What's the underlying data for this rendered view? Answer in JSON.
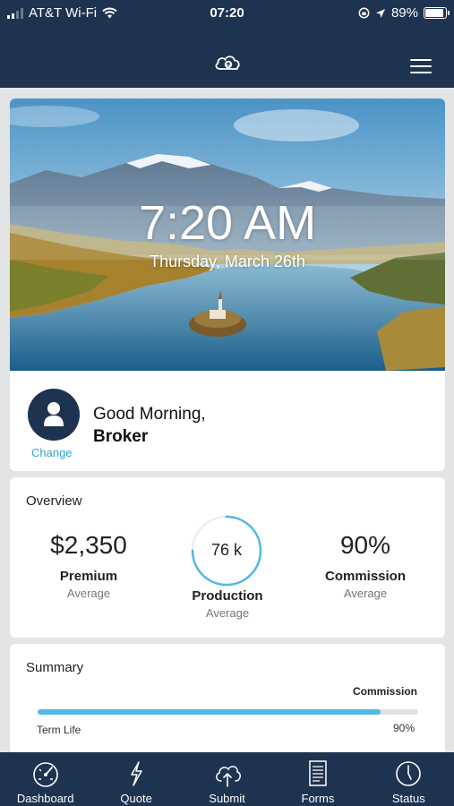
{
  "status_bar": {
    "carrier": "AT&T Wi-Fi",
    "time": "07:20",
    "battery": "89%",
    "battery_level": 0.89
  },
  "header": {
    "logo_icon": "cloud-brand-logo",
    "menu_icon": "hamburger-menu-icon"
  },
  "hero": {
    "time": "7:20 AM",
    "date": "Thursday, March 26th",
    "image": "lake-mountain-landscape"
  },
  "greeting": {
    "salutation": "Good Morning,",
    "name": "Broker",
    "change_label": "Change"
  },
  "overview": {
    "title": "Overview",
    "premium": {
      "value": "$2,350",
      "label": "Premium",
      "sub": "Average"
    },
    "production": {
      "value": "76 k",
      "label": "Production",
      "sub": "Average",
      "ring_fill": 0.75
    },
    "commission": {
      "value": "90%",
      "label": "Commission",
      "sub": "Average"
    }
  },
  "summary": {
    "title": "Summary",
    "column_header": "Commission",
    "rows": [
      {
        "label": "Term Life",
        "value": "90%",
        "fill": 0.9
      }
    ]
  },
  "tabs": [
    {
      "label": "Dashboard",
      "icon": "speedometer-icon"
    },
    {
      "label": "Quote",
      "icon": "lightning-icon"
    },
    {
      "label": "Submit",
      "icon": "cloud-upload-icon"
    },
    {
      "label": "Forms",
      "icon": "document-icon"
    },
    {
      "label": "Status",
      "icon": "clock-icon"
    }
  ],
  "colors": {
    "navy": "#1e3350",
    "accent": "#2ca6e0",
    "bar": "#53b8e6"
  }
}
